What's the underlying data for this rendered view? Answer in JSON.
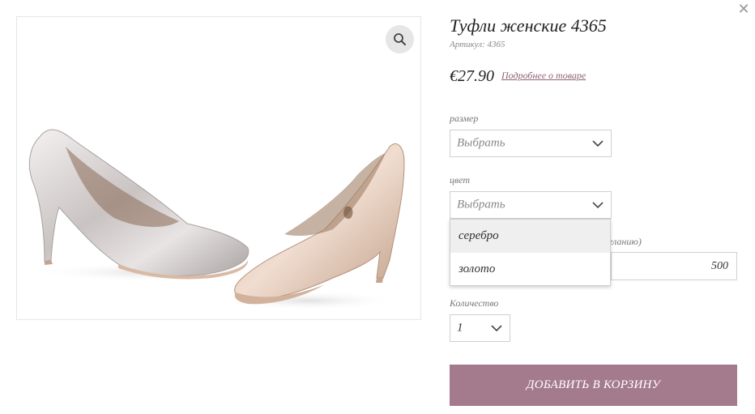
{
  "product": {
    "title": "Туфли женские 4365",
    "sku": "Артикул: 4365",
    "price": "€27.90",
    "details_link": "Подробнее о товаре",
    "image_alt": "shoes"
  },
  "options": {
    "size": {
      "label": "размер",
      "value": "Выбрать"
    },
    "color": {
      "label": "цвет",
      "value": "Выбрать",
      "dropdown_open": true,
      "options": [
        "серебро",
        "золото"
      ],
      "highlighted": "серебро"
    },
    "partial_label": "желанию)",
    "amount_value": "500",
    "quantity": {
      "label": "Количество",
      "value": "1"
    }
  },
  "cart": {
    "add_label": "ДОБАВИТЬ В КОРЗИНУ"
  },
  "colors": {
    "accent": "#a47b8c",
    "link": "#8e6075",
    "border": "#cfcfcf",
    "highlight": "#efefef"
  },
  "icons": {
    "close": "close-icon",
    "zoom": "magnifier-icon",
    "chevron": "chevron-down-icon"
  }
}
